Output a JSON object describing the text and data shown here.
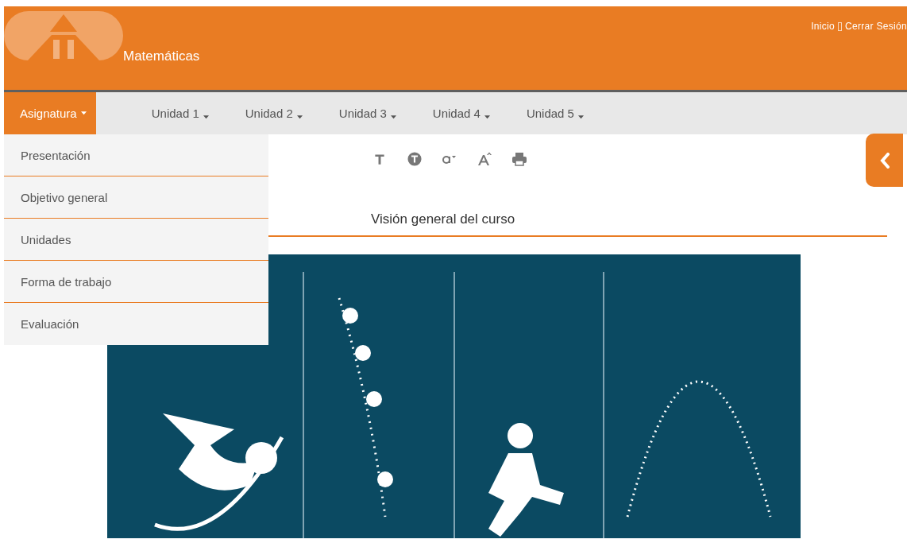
{
  "header": {
    "title": "Matemáticas",
    "links": [
      {
        "label": "Inicio"
      },
      {
        "label": "Cerrar Sesión"
      }
    ]
  },
  "nav": {
    "items": [
      {
        "label": "Asignatura",
        "selected": true
      },
      {
        "label": "Unidad 1",
        "selected": false
      },
      {
        "label": "Unidad 2",
        "selected": false
      },
      {
        "label": "Unidad 3",
        "selected": false
      },
      {
        "label": "Unidad 4",
        "selected": false
      },
      {
        "label": "Unidad 5",
        "selected": false
      }
    ]
  },
  "dropdown": {
    "items": [
      "Presentación",
      "Objetivo general",
      "Unidades",
      "Forma de trabajo",
      "Evaluación"
    ]
  },
  "section_title": "Visión general del curso"
}
